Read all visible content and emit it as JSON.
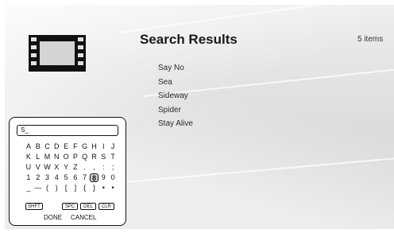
{
  "header": {
    "title": "Search Results",
    "count": "5 items"
  },
  "icons": {
    "category": "film-icon"
  },
  "results": [
    "Say No",
    "Sea",
    "Sideway",
    "Spider",
    "Stay Alive"
  ],
  "keyboard": {
    "input_value": "S_",
    "rows": [
      [
        "A",
        "B",
        "C",
        "D",
        "E",
        "F",
        "G",
        "H",
        "I",
        "J"
      ],
      [
        "K",
        "L",
        "M",
        "N",
        "O",
        "P",
        "Q",
        "R",
        "S",
        "T"
      ],
      [
        "U",
        "V",
        "W",
        "X",
        "Y",
        "Z",
        ".",
        ",",
        ":",
        ";"
      ],
      [
        "1",
        "2",
        "3",
        "4",
        "5",
        "6",
        "7",
        "8",
        "9",
        "0"
      ],
      [
        "_",
        "—",
        "(",
        ")",
        "[",
        "]",
        "{",
        "}",
        "•",
        "•"
      ]
    ],
    "selected_key": "8",
    "function_keys": {
      "shift": "SHFT",
      "space": "SPC",
      "delete": "DEL",
      "clear": "CLR"
    },
    "done_label": "DONE",
    "cancel_label": "CANCEL"
  }
}
